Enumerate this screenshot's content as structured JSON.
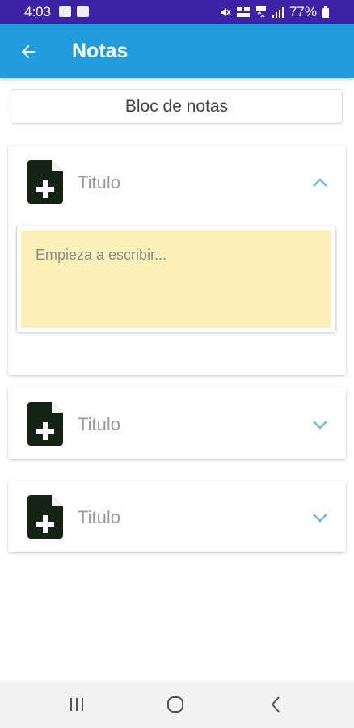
{
  "status_bar": {
    "time": "4:03",
    "battery": "77%",
    "icons": [
      "notification-icon",
      "mail-icon",
      "mute-icon",
      "vowifi-icon",
      "4g-icon",
      "signal-icon",
      "battery-icon"
    ]
  },
  "app_bar": {
    "title": "Notas",
    "back_icon": "arrow-left-icon",
    "background": "#229bdd"
  },
  "notebook": {
    "placeholder": "Bloc de notas"
  },
  "notes": [
    {
      "title": "Titulo",
      "expanded": true,
      "body_placeholder": "Empieza a escribir...",
      "icon": "note-add-icon",
      "chevron": "chevron-up-icon"
    },
    {
      "title": "Titulo",
      "expanded": false,
      "icon": "note-add-icon",
      "chevron": "chevron-down-icon"
    },
    {
      "title": "Titulo",
      "expanded": false,
      "icon": "note-add-icon",
      "chevron": "chevron-down-icon"
    }
  ],
  "nav_bar": {
    "buttons": [
      "recents-icon",
      "home-icon",
      "back-icon"
    ]
  },
  "colors": {
    "status_bar": "#3b22a6",
    "accent": "#229bdd",
    "note_paper": "#fbf0b7",
    "icon_dark": "#142314",
    "chevron": "#6fb9e3"
  }
}
